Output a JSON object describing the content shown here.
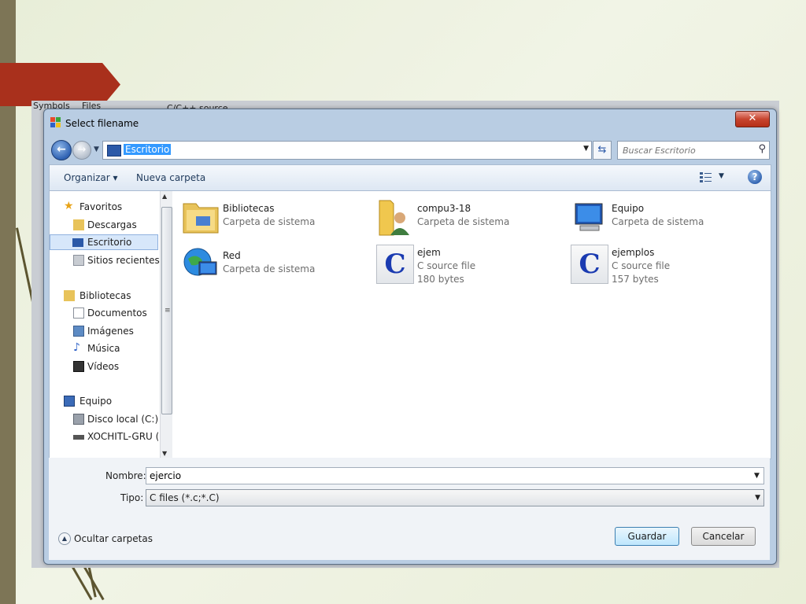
{
  "dialog": {
    "title": "Select filename"
  },
  "address": {
    "location": "Escritorio"
  },
  "search": {
    "placeholder": "Buscar Escritorio"
  },
  "toolbar": {
    "organize_label": "Organizar ▾",
    "new_folder_label": "Nueva carpeta"
  },
  "nav": {
    "items": [
      {
        "label": "Favoritos"
      },
      {
        "label": "Descargas"
      },
      {
        "label": "Escritorio"
      },
      {
        "label": "Sitios recientes"
      },
      {
        "label": "Bibliotecas"
      },
      {
        "label": "Documentos"
      },
      {
        "label": "Imágenes"
      },
      {
        "label": "Música"
      },
      {
        "label": "Vídeos"
      },
      {
        "label": "Equipo"
      },
      {
        "label": "Disco local (C:)"
      },
      {
        "label": "XOCHITL-GRU (E"
      }
    ]
  },
  "files": [
    {
      "name": "Bibliotecas",
      "desc": "Carpeta de sistema",
      "size": ""
    },
    {
      "name": "compu3-18",
      "desc": "Carpeta de sistema",
      "size": ""
    },
    {
      "name": "Equipo",
      "desc": "Carpeta de sistema",
      "size": ""
    },
    {
      "name": "Red",
      "desc": "Carpeta de sistema",
      "size": ""
    },
    {
      "name": "ejem",
      "desc": "C source file",
      "size": "180 bytes"
    },
    {
      "name": "ejemplos",
      "desc": "C source file",
      "size": "157 bytes"
    }
  ],
  "form": {
    "name_label": "Nombre:",
    "name_value": "ejercio",
    "type_label": "Tipo:",
    "type_value": "C files (*.c;*.C)"
  },
  "actions": {
    "hide_folders_label": "Ocultar carpetas",
    "save_label": "Guardar",
    "cancel_label": "Cancelar"
  },
  "background": {
    "tab_symbols": "Symbols",
    "tab_files": "Files",
    "source_label": "C/C++ source"
  },
  "colors": {
    "slide_arrow": "#a9301c",
    "slide_bar": "#7d7556",
    "selection": "#3399ff"
  }
}
